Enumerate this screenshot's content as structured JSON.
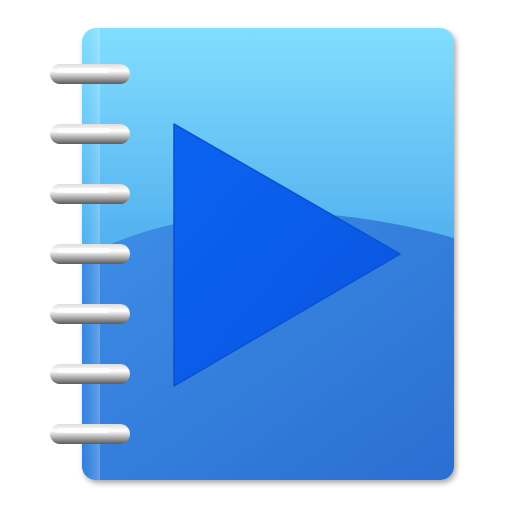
{
  "icon": {
    "name": "playlist-notebook-icon",
    "colors": {
      "cover_top": "#7fdcff",
      "cover_bottom": "#2f74d6",
      "cover_wave": "#3b86e0",
      "play_triangle": "#0b5ff0",
      "ring_light": "#f4f4f4",
      "ring_dark": "#6e6e6e",
      "background": "#ffffff"
    },
    "ring_count": 7
  }
}
